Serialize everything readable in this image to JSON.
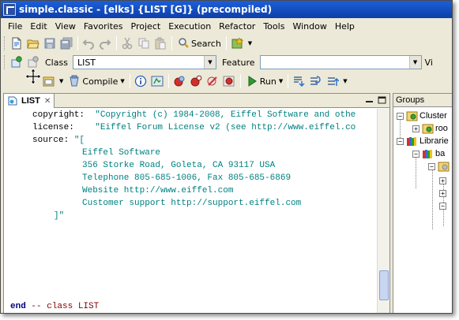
{
  "window": {
    "title": "simple.classic - [elks] {LIST [G]} (precompiled)"
  },
  "menu": [
    "File",
    "Edit",
    "View",
    "Favorites",
    "Project",
    "Execution",
    "Refactor",
    "Tools",
    "Window",
    "Help"
  ],
  "toolbar1": {
    "search_label": "Search"
  },
  "toolbar2": {
    "class_label": "Class",
    "class_value": "LIST",
    "feature_label": "Feature",
    "feature_value": "",
    "view_label": "Vi"
  },
  "toolbar3": {
    "compile_label": "Compile",
    "run_label": "Run"
  },
  "editor": {
    "tab_label": "LIST",
    "lines": [
      {
        "key": "copyright:",
        "value": "\"Copyright (c) 1984-2008, Eiffel Software and othe"
      },
      {
        "key": "license:",
        "value": "\"Eiffel Forum License v2 (see http://www.eiffel.co"
      },
      {
        "key": "source:",
        "value": "\"["
      },
      {
        "value": "Eiffel Software"
      },
      {
        "value": "356 Storke Road, Goleta, CA 93117 USA"
      },
      {
        "value": "Telephone 805-685-1006, Fax 805-685-6869"
      },
      {
        "value": "Website http://www.eiffel.com"
      },
      {
        "value": "Customer support http://support.eiffel.com"
      },
      {
        "value": "]\""
      }
    ],
    "end_keyword": "end",
    "end_comment": "-- class LIST"
  },
  "groups": {
    "title": "Groups",
    "items": [
      {
        "label": "Cluster",
        "toggle": "−"
      },
      {
        "label": "roo",
        "toggle": "+"
      },
      {
        "label": "Librarie",
        "toggle": "−"
      },
      {
        "label": "ba",
        "toggle": "−"
      },
      {
        "label": "",
        "toggle": "−"
      },
      {
        "label": "",
        "toggle": "+"
      },
      {
        "label": "",
        "toggle": "+"
      },
      {
        "label": "",
        "toggle": "−"
      }
    ]
  },
  "colors": {
    "title_bar": "#0d3fa8",
    "keyword": "#000080",
    "string": "#008080",
    "comment": "#800000",
    "chrome": "#ece9d8"
  }
}
